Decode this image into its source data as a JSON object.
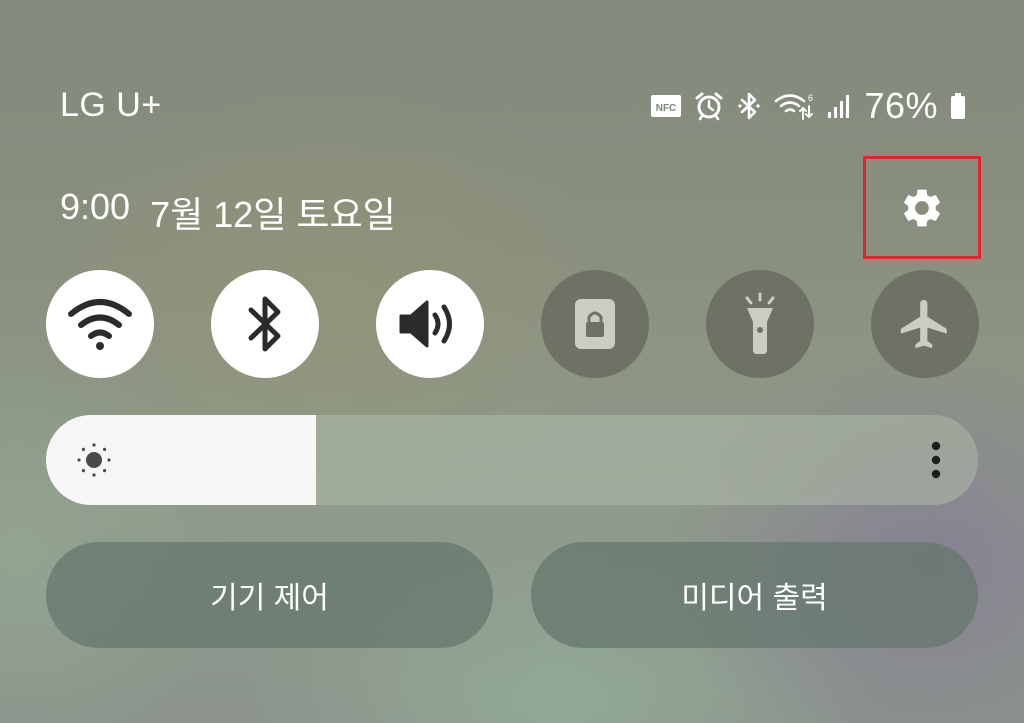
{
  "status_bar": {
    "carrier": "LG U+",
    "battery_percent": "76%",
    "icons": [
      "nfc-icon",
      "alarm-icon",
      "bluetooth-icon",
      "wifi-data-icon",
      "signal-icon",
      "battery-icon"
    ]
  },
  "header": {
    "time": "9:00",
    "date": "7월 12일 토요일",
    "settings_icon": "gear-icon"
  },
  "quick_settings": [
    {
      "id": "wifi",
      "icon": "wifi-icon",
      "state": "on"
    },
    {
      "id": "bluetooth",
      "icon": "bluetooth-icon",
      "state": "on"
    },
    {
      "id": "sound",
      "icon": "volume-icon",
      "state": "on"
    },
    {
      "id": "rotation-lock",
      "icon": "rotation-lock-icon",
      "state": "off"
    },
    {
      "id": "flashlight",
      "icon": "flashlight-icon",
      "state": "off"
    },
    {
      "id": "airplane",
      "icon": "airplane-icon",
      "state": "off"
    }
  ],
  "brightness": {
    "level": 0.29
  },
  "buttons": {
    "device_control": "기기 제어",
    "media_output": "미디어 출력"
  },
  "colors": {
    "highlight_box": "#e0262a",
    "tile_on": "#ffffff",
    "tile_off": "#6d7265",
    "icon_dark": "#2b2b2b",
    "icon_light": "#c9cdc4"
  }
}
